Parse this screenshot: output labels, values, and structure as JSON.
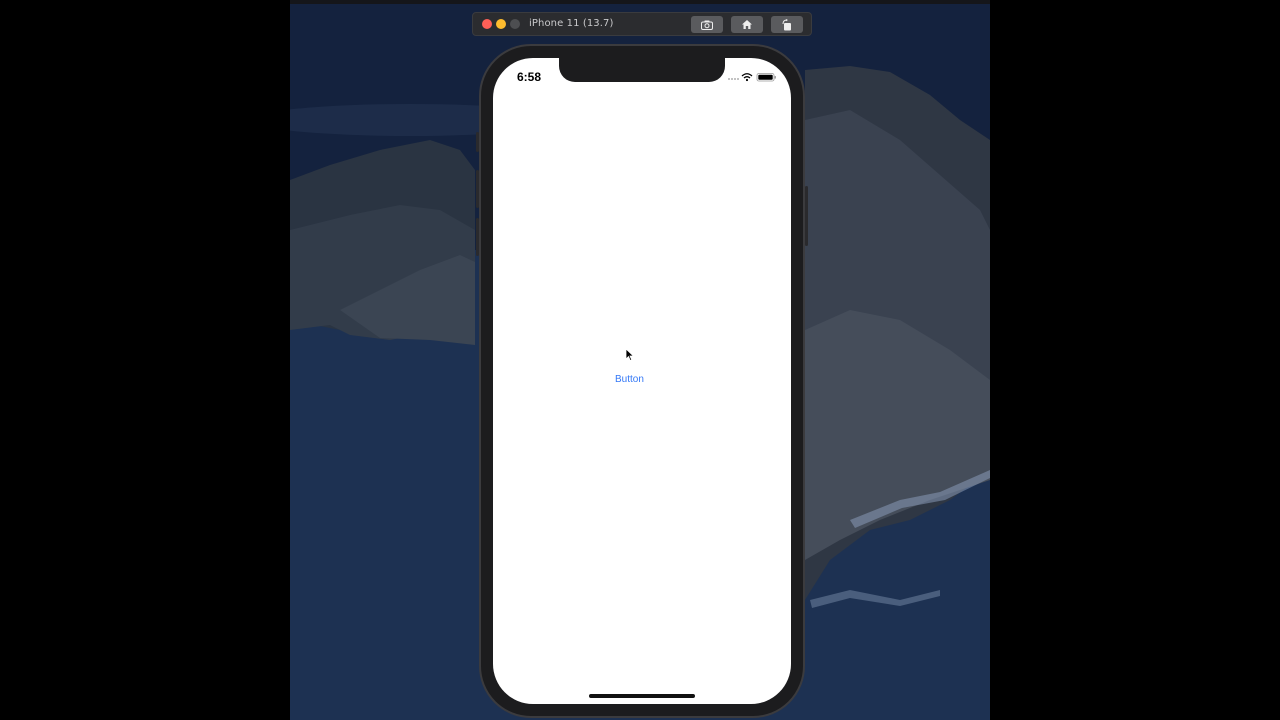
{
  "simulator": {
    "window_title": "iPhone 11 (13.7)",
    "toolbar": {
      "screenshot_icon": "camera-icon",
      "home_icon": "home-icon",
      "rotate_icon": "rotate-icon"
    }
  },
  "device": {
    "status_bar": {
      "time": "6:58",
      "icons": [
        "cellular-dots-icon",
        "wifi-icon",
        "battery-icon"
      ]
    },
    "app": {
      "button_label": "Button"
    }
  },
  "colors": {
    "accent": "#3478f6",
    "close": "#fe5f57",
    "minimize": "#febc2e"
  }
}
